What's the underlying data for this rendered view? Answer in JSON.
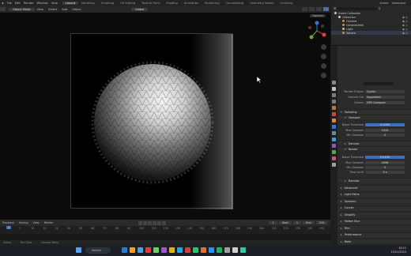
{
  "topbar": {
    "menus": [
      "File",
      "Edit",
      "Render",
      "Window",
      "Help"
    ],
    "tabs": [
      "Layout",
      "Modeling",
      "Sculpting",
      "UV Editing",
      "Texture Paint",
      "Shading",
      "Animation",
      "Rendering",
      "Compositing",
      "Geometry Nodes",
      "Scripting"
    ],
    "active_tab": 0,
    "scene_label": "Scene",
    "view_layer_label": "ViewLayer"
  },
  "viewport_header": {
    "items": [
      "Object Mode",
      "View",
      "Select",
      "Add",
      "Object"
    ],
    "transform": "Global",
    "options_label": "Options"
  },
  "outliner": {
    "title": "Scene Collection",
    "rows": [
      {
        "label": "Scene Collection",
        "color": "#cfcfcf",
        "indent": 0
      },
      {
        "label": "Collection",
        "color": "#cfcfcf",
        "indent": 1
      },
      {
        "label": "Camera",
        "color": "#d08b4b",
        "indent": 2
      },
      {
        "label": "CameraOrbit",
        "color": "#d08b4b",
        "indent": 2
      },
      {
        "label": "Light",
        "color": "#d9c25a",
        "indent": 2
      },
      {
        "label": "Sphere",
        "color": "#d08b4b",
        "indent": 2
      }
    ]
  },
  "properties": {
    "render_engine_label": "Render Engine",
    "render_engine": "Cycles",
    "feature_set_label": "Feature Set",
    "feature_set": "Supported",
    "device_label": "Device",
    "device": "GPU Compute",
    "sampling_label": "Sampling",
    "viewport_label": "Viewport",
    "noise_threshold_label": "Noise Threshold",
    "viewport_noise_threshold": "0.1000",
    "max_samples_label": "Max Samples",
    "viewport_max_samples": "1024",
    "min_samples_label": "Min Samples",
    "viewport_min_samples": "0",
    "denoise_label": "Denoise",
    "render_label": "Render",
    "render_noise_threshold": "0.0100",
    "render_max_samples": "4096",
    "render_min_samples": "0",
    "time_limit_label": "Time Limit",
    "time_limit": "0 s",
    "render_denoise_label": "Denoise",
    "sections": [
      "Advanced",
      "Light Paths",
      "Volumes",
      "Curves",
      "Simplify",
      "Motion Blur",
      "Film",
      "Performance",
      "Bake"
    ]
  },
  "timeline": {
    "menus": [
      "Playback",
      "Keying",
      "View",
      "Marker"
    ],
    "current_frame": "1",
    "start_label": "Start",
    "start": "1",
    "end_label": "End",
    "end": "250",
    "ticks": [
      "1",
      "10",
      "20",
      "30",
      "40",
      "50",
      "60",
      "70",
      "80",
      "90",
      "100",
      "110",
      "120",
      "130",
      "140",
      "150",
      "160",
      "170",
      "180",
      "190",
      "200",
      "210",
      "220",
      "230",
      "240",
      "250"
    ]
  },
  "status_bar": {
    "left": "Select",
    "middle": "Pan View",
    "right": "Context Menu"
  },
  "taskbar": {
    "search_label": "Search",
    "time": "18:21",
    "date": "12/01/2023",
    "app_colors": [
      "#2e7bd6",
      "#f0a030",
      "#4a9fe0",
      "#e03a3a",
      "#6bd06b",
      "#9b59d0",
      "#e0b020",
      "#2aa0e0",
      "#d04040",
      "#30c070",
      "#e07030",
      "#3090f0",
      "#20b060",
      "#a0a0a0",
      "#d0d0d0",
      "#40c0a0"
    ]
  },
  "colors": {
    "accent_blue": "#3f6fbf",
    "gizmo_red": "#e0433e",
    "gizmo_green": "#6ea637",
    "gizmo_blue": "#3b74d6"
  }
}
